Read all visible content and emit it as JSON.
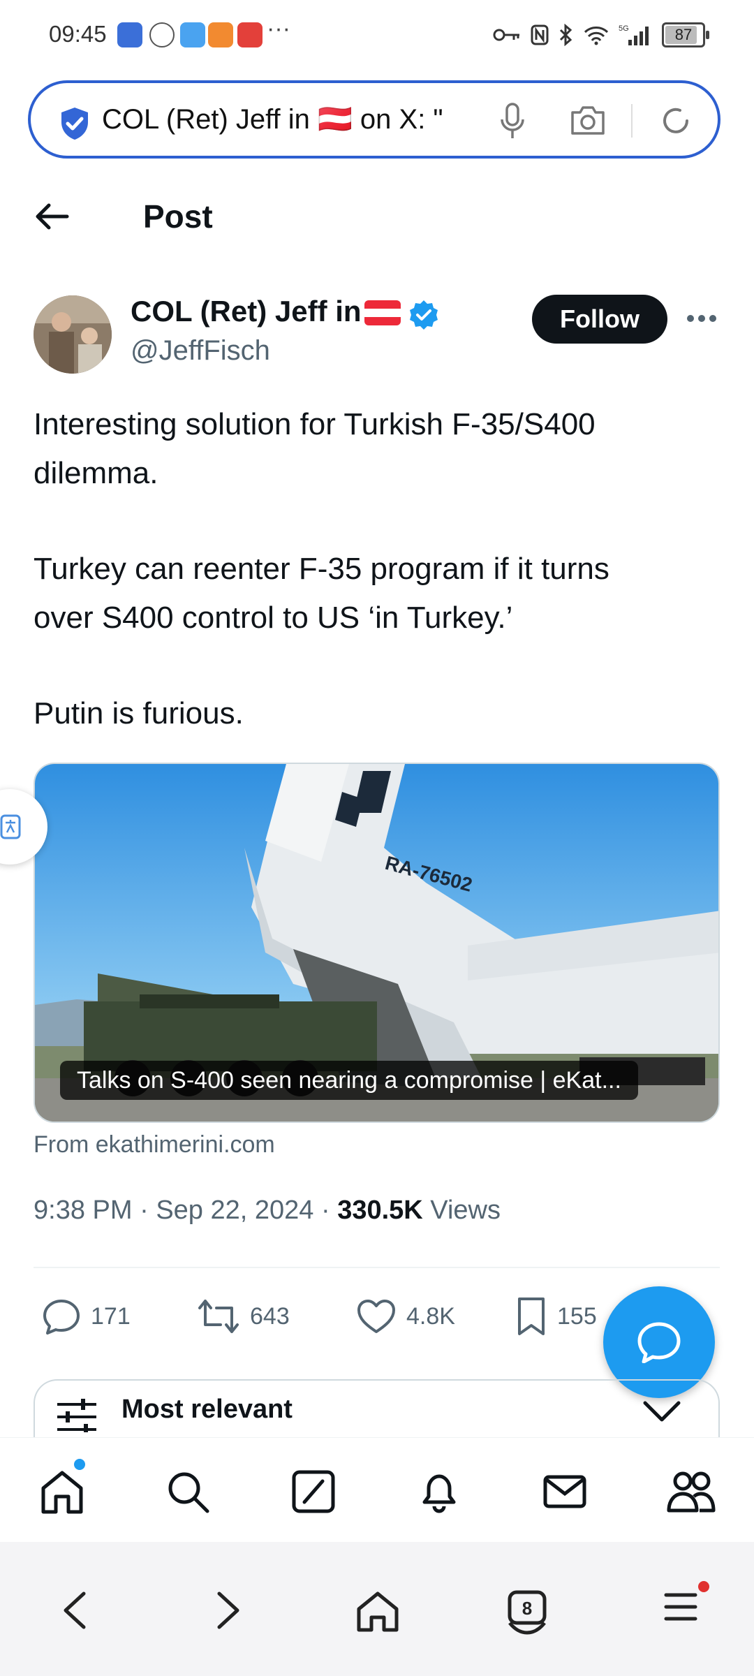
{
  "status_bar": {
    "time": "09:45",
    "network": "5G",
    "battery": "87",
    "battery_level": 0.87,
    "app_icons": [
      "app-icon-1",
      "app-icon-2",
      "weather-icon",
      "video-icon",
      "huawei-app-icon"
    ]
  },
  "browser": {
    "url_text": "COL (Ret) Jeff in 🇦🇹 on X: \""
  },
  "header": {
    "title": "Post"
  },
  "author": {
    "name": "COL (Ret) Jeff in",
    "handle": "@JeffFisch",
    "follow_label": "Follow"
  },
  "post": {
    "lines": [
      "Interesting solution for Turkish F-35/S400",
      "dilemma.",
      "Turkey can reenter F-35 program if it turns",
      "over S400 control to US ‘in Turkey.’",
      "Putin is furious."
    ]
  },
  "card": {
    "image_text": "RA-76502",
    "caption": "Talks on S-400 seen nearing a compromise | eKat...",
    "source": "From ekathimerini.com"
  },
  "meta": {
    "time": "9:38 PM",
    "date": "Sep 22, 2024",
    "views_count": "330.5K",
    "views_label": "Views"
  },
  "actions": {
    "replies": "171",
    "reposts": "643",
    "likes": "4.8K",
    "bookmarks": "155"
  },
  "sort": {
    "label": "Most relevant"
  },
  "colors": {
    "accent": "#1d9bf0",
    "url_border": "#2d5fd0",
    "text": "#0f1419",
    "muted": "#536471"
  }
}
